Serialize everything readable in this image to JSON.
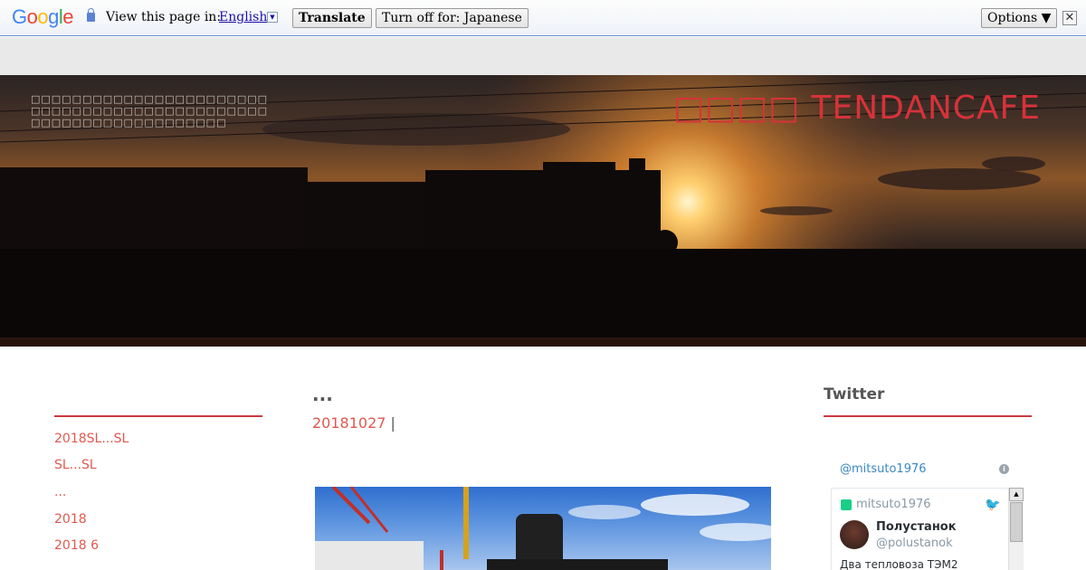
{
  "translate_bar": {
    "logo": "Google",
    "prompt": "View this page in:",
    "language": "English",
    "translate_label": "Translate",
    "turn_off_label": "Turn off for: Japanese",
    "options_label": "Options ▼",
    "close_label": "✕"
  },
  "header": {
    "site_title": "□□□□ TENDANCAFE",
    "tagline": "□□□□□□□□□□□□□□□□□□□□□□□□□□□□□□□□□□□□□□□□□□□□□□□□□□□□□□□□□□□□□□□□□"
  },
  "left_sidebar": {
    "items": [
      {
        "label": "2018SL...SL"
      },
      {
        "label": "SL...SL"
      },
      {
        "label": "..."
      },
      {
        "label": "2018"
      },
      {
        "label": "2018  6"
      }
    ]
  },
  "post": {
    "title": "...",
    "date": "20181027",
    "separator": "|"
  },
  "right_sidebar": {
    "title": "Twitter",
    "timeline_handle": "@mitsuto1976",
    "info_icon": "i",
    "tweet": {
      "retweeted_by": "mitsuto1976",
      "name": "Полустанок",
      "username": "@polustanok",
      "text": "Два тепловоза ТЭМ2"
    }
  },
  "colors": {
    "accent_red": "#d6323a",
    "link_salmon": "#e0584f",
    "twitter_blue": "#3b88c3"
  }
}
